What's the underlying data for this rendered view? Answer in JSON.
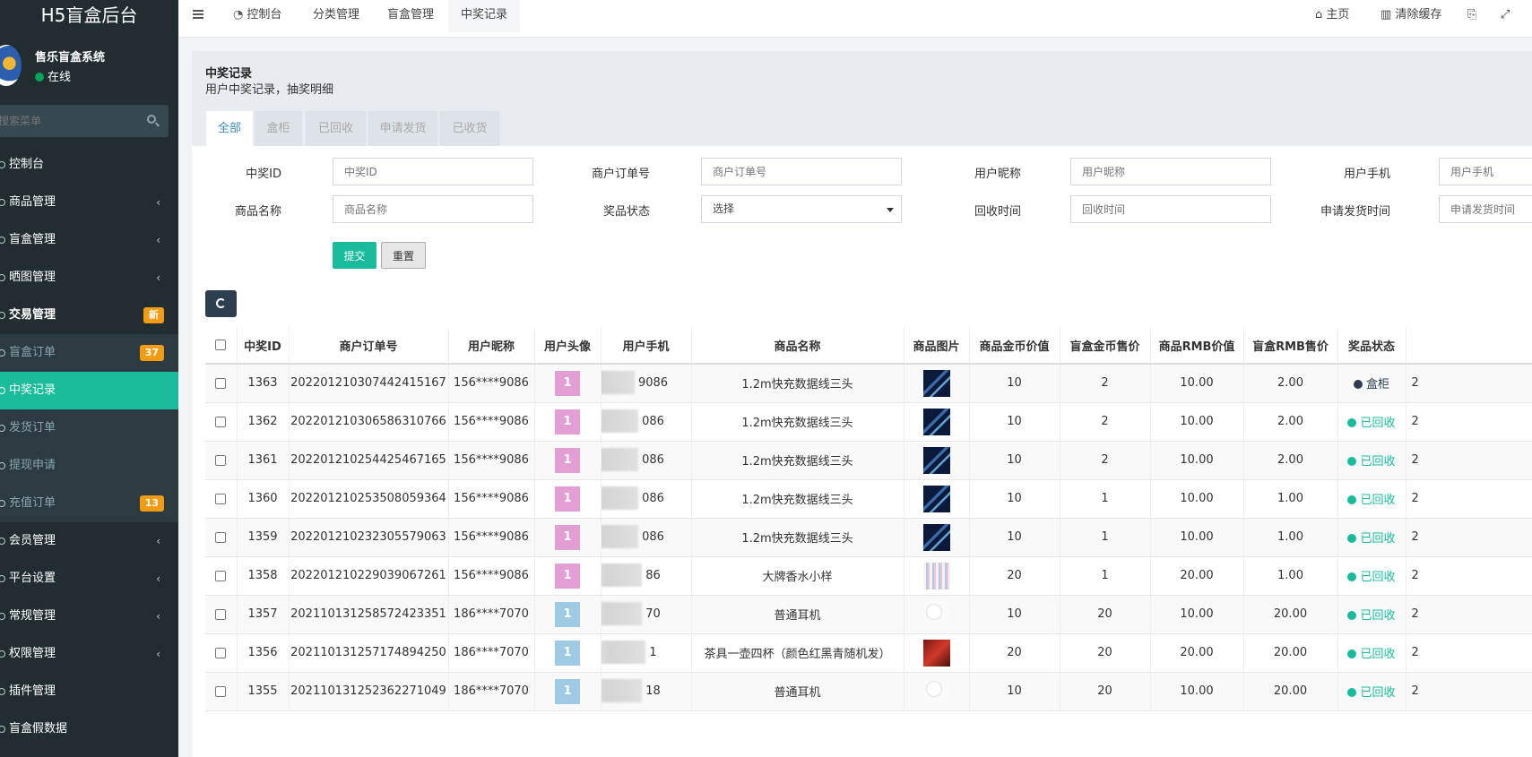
{
  "app": {
    "logo": "H5盲盒后台"
  },
  "user": {
    "name": "售乐盲盒系统",
    "status": "在线"
  },
  "sidebar": {
    "search_placeholder": "搜索菜单",
    "items": [
      {
        "label": "控制台"
      },
      {
        "label": "商品管理"
      },
      {
        "label": "盲盒管理"
      },
      {
        "label": "晒图管理"
      },
      {
        "label": "交易管理",
        "badge": "新"
      },
      {
        "label": "盲盒订单",
        "badge": "37"
      },
      {
        "label": "中奖记录"
      },
      {
        "label": "发货订单"
      },
      {
        "label": "提现申请"
      },
      {
        "label": "充值订单",
        "badge": "13"
      },
      {
        "label": "会员管理"
      },
      {
        "label": "平台设置"
      },
      {
        "label": "常规管理"
      },
      {
        "label": "权限管理"
      },
      {
        "label": "插件管理"
      },
      {
        "label": "盲盒假数据"
      }
    ]
  },
  "header": {
    "tabs": [
      "控制台",
      "分类管理",
      "盲盒管理",
      "中奖记录"
    ],
    "home": "主页",
    "clear_cache": "清除缓存"
  },
  "page": {
    "title": "中奖记录",
    "subtitle": "用户中奖记录，抽奖明细",
    "filter_tabs": [
      "全部",
      "盒柜",
      "已回收",
      "申请发货",
      "已收货"
    ]
  },
  "form": {
    "award_id": {
      "label": "中奖ID",
      "placeholder": "中奖ID"
    },
    "merchant_order": {
      "label": "商户订单号",
      "placeholder": "商户订单号"
    },
    "nickname": {
      "label": "用户昵称",
      "placeholder": "用户昵称"
    },
    "phone": {
      "label": "用户手机",
      "placeholder": "用户手机"
    },
    "goods_name": {
      "label": "商品名称",
      "placeholder": "商品名称"
    },
    "prize_status": {
      "label": "奖品状态",
      "value": "选择"
    },
    "recycle_time": {
      "label": "回收时间",
      "placeholder": "回收时间"
    },
    "delivery_time": {
      "label": "申请发货时间",
      "placeholder": "申请发货时间"
    },
    "submit": "提交",
    "reset": "重置"
  },
  "table": {
    "columns": [
      "中奖ID",
      "商户订单号",
      "用户昵称",
      "用户头像",
      "用户手机",
      "商品名称",
      "商品图片",
      "商品金币价值",
      "盲盒金币售价",
      "商品RMB价值",
      "盲盒RMB售价",
      "奖品状态"
    ],
    "rows": [
      {
        "id": "1363",
        "order": "20220121030744241516​7",
        "nick": "156****9086",
        "avatar": "1",
        "phone": "9086",
        "goods": "1.2m快充数据线三头",
        "coin_value": "10",
        "coin_price": "2",
        "rmb_value": "10.00",
        "rmb_price": "2.00",
        "status": "盒柜",
        "extra": "2"
      },
      {
        "id": "1362",
        "order": "20220121030658631076​6",
        "nick": "156****9086",
        "avatar": "1",
        "phone": "086",
        "goods": "1.2m快充数据线三头",
        "coin_value": "10",
        "coin_price": "2",
        "rmb_value": "10.00",
        "rmb_price": "2.00",
        "status": "已回收",
        "extra": "2"
      },
      {
        "id": "1361",
        "order": "20220121025442546716​5",
        "nick": "156****9086",
        "avatar": "1",
        "phone": "086",
        "goods": "1.2m快充数据线三头",
        "coin_value": "10",
        "coin_price": "2",
        "rmb_value": "10.00",
        "rmb_price": "2.00",
        "status": "已回收",
        "extra": "2"
      },
      {
        "id": "1360",
        "order": "20220121025350805936​4",
        "nick": "156****9086",
        "avatar": "1",
        "phone": "086",
        "goods": "1.2m快充数据线三头",
        "coin_value": "10",
        "coin_price": "1",
        "rmb_value": "10.00",
        "rmb_price": "1.00",
        "status": "已回收",
        "extra": "2"
      },
      {
        "id": "1359",
        "order": "20220121023230557906​3",
        "nick": "156****9086",
        "avatar": "1",
        "phone": "086",
        "goods": "1.2m快充数据线三头",
        "coin_value": "10",
        "coin_price": "1",
        "rmb_value": "10.00",
        "rmb_price": "1.00",
        "status": "已回收",
        "extra": "2"
      },
      {
        "id": "1358",
        "order": "20220121022903906726​1",
        "nick": "156****9086",
        "avatar": "1",
        "phone": "86",
        "goods": "大牌香水小样",
        "coin_value": "20",
        "coin_price": "1",
        "rmb_value": "20.00",
        "rmb_price": "1.00",
        "status": "已回收",
        "extra": "2"
      },
      {
        "id": "1357",
        "order": "20211013125857242335​1",
        "nick": "186****7070",
        "avatar": "1",
        "phone": "70",
        "goods": "普通耳机",
        "coin_value": "10",
        "coin_price": "20",
        "rmb_value": "10.00",
        "rmb_price": "20.00",
        "status": "已回收",
        "extra": "2"
      },
      {
        "id": "1356",
        "order": "20211013125717489425​0",
        "nick": "186****7070",
        "avatar": "1",
        "phone": "1",
        "goods": "茶具一壶四杯（颜色红黑青随机发）",
        "coin_value": "20",
        "coin_price": "20",
        "rmb_value": "20.00",
        "rmb_price": "20.00",
        "status": "已回收",
        "extra": "2"
      },
      {
        "id": "1355",
        "order": "20211013125236227104​9",
        "nick": "186****7070",
        "avatar": "1",
        "phone": "18",
        "goods": "普通耳机",
        "coin_value": "10",
        "coin_price": "20",
        "rmb_value": "10.00",
        "rmb_price": "20.00",
        "status": "已回收",
        "extra": "2"
      }
    ]
  },
  "colors": {
    "sidebar_bg": "#222d32",
    "accent": "#1abc9c",
    "badge": "#f39c12",
    "status_box": "#2c3e50",
    "status_recycled": "#18bc9c",
    "avatar_pink": "#e39ed3",
    "avatar_blue": "#9ecbe3"
  }
}
